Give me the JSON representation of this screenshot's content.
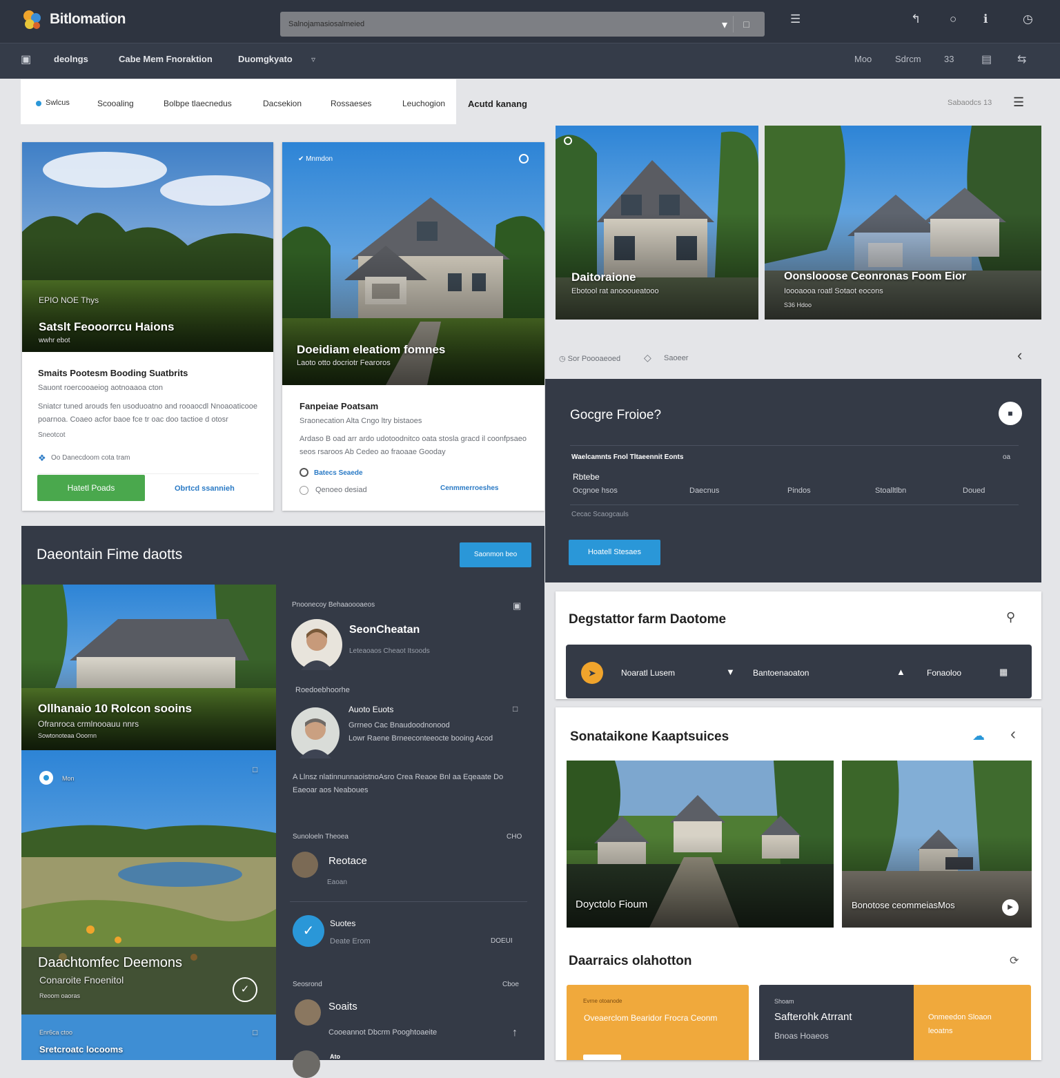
{
  "app": {
    "brand": "Bitlomation",
    "search_placeholder": "Salnojamasiosalmeied"
  },
  "top_icons": [
    "list-icon",
    "back-icon",
    "circle-icon",
    "info-icon",
    "clock-icon"
  ],
  "nav": {
    "items": [
      "deolngs",
      "Cabe Mem Fnoraktion",
      "Duomgkyato"
    ],
    "right": [
      "Moo",
      "Sdrcm",
      "33",
      "",
      ""
    ]
  },
  "subtabs": {
    "items": [
      "Swlcus",
      "Scooaling",
      "Bolbpe tlaecnedus",
      "Dacsekion",
      "Rossaeses",
      "Leuchogion"
    ],
    "active": "Acutd kanang",
    "right": "Sabaodcs 13"
  },
  "card1": {
    "overlay_small": "EPIO  NOE  Thys",
    "overlay_title": "Satslt Feooorrcu Haions",
    "overlay_sub": "wwhr ebot",
    "title": "Smaits Pootesm Booding Suatbrits",
    "subtitle": "Sauont roercooaeiog aotnoaaoa cton",
    "body": "Sniatcr tuned arouds fen usoduoatno and rooaocdl Nnoaoaticooe poarnoa. Coaeo acfor baoe fce tr oac doo tactioe d otosr",
    "meta": "Sneotcot",
    "info": "Oo  Danecdoom cota tram",
    "primary": "Hatetl Poads",
    "secondary": "Obrtcd ssannieh"
  },
  "card2": {
    "badge": "Mnmdon",
    "overlay_title": "Doeidiam eleatiom fomnes",
    "overlay_sub": "Laoto otto docriotr Fearoros",
    "title": "Fanpeiae Poatsam",
    "subtitle": "Sraonecation Alta Cngo ltry bistaoes",
    "body": "Ardaso B oad arr ardo udotoodnitco oata stosla gracd il coonfpsaeo seos rsaroos Ab Cedeo ao fraoaae Gooday",
    "opt1": "Batecs Seaede",
    "opt2": "Qenoeo desiad",
    "link": "Cenmmerroeshes"
  },
  "photos_top": [
    {
      "title": "Daitoraione",
      "sub": "Ebotool rat anoooueatooo"
    },
    {
      "title": "Oonslooose  Ceonronas  Foom  Eior",
      "sub": "Ioooaooa roatl Sotaot eocons",
      "tag": "S36 Hdoo"
    }
  ],
  "mid_meta": {
    "left": "Sor Poooaeoed",
    "right": "Saoeer"
  },
  "dark_panel": {
    "title": "Gocgre Froioe?",
    "row_label": "Waelcamnts Fnol Tltaeennit Eonts",
    "row_right": "oa",
    "sub_label": "Rbtebe",
    "columns": [
      "Ocgnoe hsos",
      "Daecnus",
      "Pindos",
      "Stoalltlbn",
      "Doued"
    ],
    "footer": "Cecac Scaogcauls",
    "button": "Hoatell Stesaes"
  },
  "featured": {
    "title": "Daeontain Fime daotts",
    "button": "Saonmon beo",
    "photo1_title": "Ollhanaio 10 Rolcon sooins",
    "photo1_sub": "Ofranroca crmlnooauu nnrs",
    "photo1_sub2": "Sowtonoteaa Ooornn",
    "photo2_tag": "Mon",
    "photo2_title": "Daachtomfec Deemons",
    "photo2_sub": "Conaroite Fnoenitol",
    "photo2_sub2": "Reoom oaoras",
    "photo3_tag": "Enr6ca ctoo",
    "photo3_title": "Sretcroatc locooms"
  },
  "people": {
    "header": "Pnoonecoy Behaaoooaeos",
    "person1": {
      "name": "SeonCheatan",
      "role": "Leteaoaos Cheaot Itsoods"
    },
    "section2": "Roedoebhoorhe",
    "person2": {
      "name": "Auoto Euots",
      "line1": "Grrneo Cac Bnaudoodnonood",
      "line2": "Lowr Raene Brneeconteeocte booing Acod"
    },
    "quote": "A Llnsz  nlatinnunnaoistnoAsro Crea  Reaoe Bnl aa Eqeaate Do Eaeoar aos Neaboues",
    "section3": "Sunoloeln Theoea",
    "section3_right": "CHO",
    "item1": {
      "name": "Reotace",
      "sub": "Eaoan"
    },
    "item2": {
      "name": "Suotes",
      "sub": "Deate Erom",
      "right": "DOEUI"
    },
    "section4": "Seosrond",
    "section4_right": "Cboe",
    "item3": {
      "name": "Soaits",
      "sub": "Cooeannot Dbcrm Pooghtoaeite"
    },
    "item4": {
      "name": "Ato"
    }
  },
  "destination": {
    "title": "Degstattor farm Daotome",
    "bar_items": [
      "Noaratl Lusem",
      "Bantoenaoaton",
      "Fonaoloo"
    ]
  },
  "gallery": {
    "title": "Sonataikone Kaaptsuices",
    "photo1": "Doyctolo Fioum",
    "photo2": "Bonotose ceommeiasMos"
  },
  "bottom": {
    "title": "Daarraics olahotton",
    "card1_tag": "Evrne otoanode",
    "card1_text": "Oveaerclom Bearidor Frocra Ceonm",
    "card2_tag": "Shoam",
    "card2_title": "Safterohk Atrrant",
    "card2_sub": "Bnoas Hoaeos",
    "card3_text": "Onmeedon Sloaon leoatns"
  }
}
